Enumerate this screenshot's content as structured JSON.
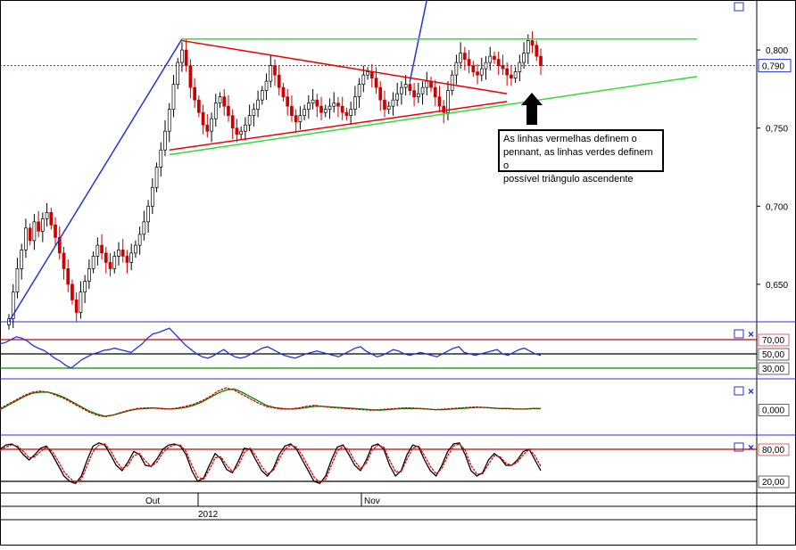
{
  "chart_data": [
    {
      "type": "candlestick",
      "panel": "price",
      "title": "",
      "y_ticks": [
        "0,800",
        "0,750",
        "0,700",
        "0,650"
      ],
      "ylim": [
        0.626,
        0.832
      ],
      "last_price_label": "0,790",
      "last_price": 0.79,
      "x_ticks": [
        "Out",
        "Nov"
      ],
      "year_label": "2012",
      "annotation": "As linhas vermelhas definem o pennant, as linhas verdes definem o possível triângulo ascendente",
      "annotation_lines": [
        "As linhas vermelhas definem o",
        "pennant, as linhas verdes definem o",
        "possível triângulo ascendente"
      ],
      "colors": {
        "up": "#000000",
        "down": "#cc0000",
        "pennant": "#ee0000",
        "triangle": "#33dd33",
        "trend": "#2233dd",
        "price_line": "#cc0000"
      },
      "close_series": [
        0.628,
        0.645,
        0.66,
        0.672,
        0.686,
        0.678,
        0.69,
        0.684,
        0.692,
        0.696,
        0.688,
        0.68,
        0.67,
        0.66,
        0.65,
        0.64,
        0.632,
        0.645,
        0.652,
        0.66,
        0.668,
        0.675,
        0.67,
        0.664,
        0.66,
        0.668,
        0.672,
        0.668,
        0.664,
        0.67,
        0.675,
        0.682,
        0.69,
        0.7,
        0.712,
        0.725,
        0.736,
        0.748,
        0.762,
        0.778,
        0.792,
        0.8,
        0.79,
        0.776,
        0.768,
        0.76,
        0.752,
        0.748,
        0.756,
        0.766,
        0.77,
        0.764,
        0.758,
        0.75,
        0.746,
        0.748,
        0.752,
        0.758,
        0.762,
        0.768,
        0.774,
        0.78,
        0.79,
        0.784,
        0.776,
        0.77,
        0.764,
        0.758,
        0.754,
        0.758,
        0.762,
        0.766,
        0.768,
        0.764,
        0.76,
        0.762,
        0.764,
        0.766,
        0.764,
        0.76,
        0.758,
        0.762,
        0.77,
        0.778,
        0.784,
        0.786,
        0.782,
        0.776,
        0.768,
        0.762,
        0.764,
        0.768,
        0.772,
        0.776,
        0.778,
        0.774,
        0.77,
        0.772,
        0.776,
        0.78,
        0.776,
        0.77,
        0.764,
        0.76,
        0.774,
        0.784,
        0.792,
        0.798,
        0.794,
        0.79,
        0.786,
        0.784,
        0.788,
        0.792,
        0.796,
        0.794,
        0.79,
        0.788,
        0.784,
        0.782,
        0.786,
        0.792,
        0.798,
        0.806,
        0.803,
        0.796,
        0.79
      ],
      "lines": [
        {
          "name": "trend-up-1",
          "color": "#2233dd",
          "from": [
            0,
            0.626
          ],
          "to": [
            41,
            0.807
          ]
        },
        {
          "name": "trend-up-2",
          "color": "#2233dd",
          "from": [
            95,
            0.78
          ],
          "to": [
            99,
            0.832
          ]
        },
        {
          "name": "pennant-upper",
          "color": "#ee0000",
          "from": [
            41,
            0.806
          ],
          "to": [
            118,
            0.772
          ]
        },
        {
          "name": "pennant-lower",
          "color": "#ee0000",
          "from": [
            38,
            0.736
          ],
          "to": [
            118,
            0.767
          ]
        },
        {
          "name": "triangle-top",
          "color": "#33dd33",
          "from": [
            41,
            0.807
          ],
          "to": [
            163,
            0.807
          ]
        },
        {
          "name": "triangle-bottom",
          "color": "#33dd33",
          "from": [
            38,
            0.733
          ],
          "to": [
            163,
            0.783
          ]
        }
      ]
    },
    {
      "type": "line",
      "panel": "rsi",
      "y_ticks": [
        "70,00",
        "50,00",
        "30,00"
      ],
      "ylim": [
        20,
        90
      ],
      "levels": [
        {
          "value": 70,
          "color": "#cc0000"
        },
        {
          "value": 50,
          "color": "#000000"
        },
        {
          "value": 30,
          "color": "#008800"
        }
      ],
      "series": [
        {
          "color": "#2233dd",
          "values": [
            64,
            66,
            70,
            74,
            72,
            68,
            62,
            58,
            55,
            50,
            44,
            40,
            34,
            30,
            36,
            42,
            46,
            50,
            52,
            55,
            56,
            58,
            56,
            54,
            52,
            58,
            64,
            72,
            78,
            80,
            83,
            86,
            78,
            70,
            62,
            56,
            50,
            46,
            44,
            47,
            52,
            56,
            50,
            46,
            44,
            46,
            50,
            54,
            58,
            60,
            56,
            52,
            48,
            46,
            44,
            47,
            50,
            52,
            54,
            52,
            50,
            48,
            46,
            50,
            54,
            58,
            60,
            54,
            50,
            46,
            48,
            52,
            56,
            54,
            50,
            48,
            50,
            52,
            50,
            48,
            46,
            50,
            54,
            58,
            60,
            52,
            50,
            48,
            50,
            52,
            54,
            56,
            50,
            48,
            52,
            56,
            58,
            54,
            50,
            48
          ]
        }
      ]
    },
    {
      "type": "line",
      "panel": "macd",
      "y_ticks": [
        "0,000"
      ],
      "ylim": [
        -0.04,
        0.05
      ],
      "series": [
        {
          "color": "#008800",
          "values": [
            0.0,
            0.008,
            0.016,
            0.024,
            0.03,
            0.032,
            0.032,
            0.028,
            0.022,
            0.014,
            0.006,
            -0.002,
            -0.008,
            -0.012,
            -0.01,
            -0.006,
            -0.002,
            0.001,
            0.002,
            0.003,
            0.002,
            0.001,
            0.002,
            0.004,
            0.008,
            0.014,
            0.022,
            0.03,
            0.036,
            0.038,
            0.032,
            0.024,
            0.016,
            0.008,
            0.004,
            0.002,
            0.001,
            0.002,
            0.004,
            0.006,
            0.006,
            0.005,
            0.004,
            0.003,
            0.002,
            0.001,
            0.0,
            -0.001,
            0.0,
            0.001,
            0.002,
            0.002,
            0.002,
            0.001,
            0.0,
            0.0,
            0.001,
            0.002,
            0.003,
            0.004,
            0.004,
            0.003,
            0.002,
            0.002,
            0.001,
            0.001,
            0.002,
            0.002
          ]
        },
        {
          "color": "#cc0000",
          "values": [
            0.002,
            0.01,
            0.018,
            0.026,
            0.032,
            0.034,
            0.032,
            0.026,
            0.02,
            0.012,
            0.004,
            -0.004,
            -0.01,
            -0.013,
            -0.01,
            -0.005,
            -0.001,
            0.002,
            0.003,
            0.003,
            0.002,
            0.001,
            0.003,
            0.006,
            0.01,
            0.016,
            0.024,
            0.034,
            0.04,
            0.036,
            0.028,
            0.02,
            0.012,
            0.006,
            0.003,
            0.001,
            0.001,
            0.003,
            0.006,
            0.008,
            0.006,
            0.004,
            0.003,
            0.002,
            0.001,
            0.0,
            -0.001,
            0.0,
            0.001,
            0.002,
            0.003,
            0.003,
            0.002,
            0.001,
            0.0,
            0.001,
            0.002,
            0.003,
            0.004,
            0.005,
            0.004,
            0.003,
            0.002,
            0.002,
            0.001,
            0.001,
            0.002,
            0.002
          ]
        }
      ]
    },
    {
      "type": "line",
      "panel": "stochastic",
      "y_ticks": [
        "80,00",
        "20,00"
      ],
      "ylim": [
        5,
        100
      ],
      "levels": [
        {
          "value": 80,
          "color": "#cc0000"
        },
        {
          "value": 20,
          "color": "#000000"
        }
      ],
      "series": [
        {
          "color": "#000000",
          "values": [
            80,
            88,
            90,
            84,
            70,
            60,
            70,
            82,
            86,
            70,
            50,
            30,
            20,
            16,
            30,
            60,
            86,
            92,
            88,
            70,
            50,
            40,
            56,
            76,
            70,
            50,
            48,
            62,
            80,
            88,
            90,
            86,
            70,
            40,
            20,
            26,
            50,
            72,
            62,
            42,
            36,
            58,
            82,
            80,
            60,
            40,
            30,
            44,
            70,
            86,
            90,
            80,
            60,
            40,
            20,
            16,
            30,
            60,
            84,
            88,
            70,
            50,
            40,
            60,
            86,
            90,
            80,
            50,
            30,
            40,
            70,
            88,
            84,
            60,
            40,
            30,
            50,
            76,
            90,
            92,
            70,
            40,
            30,
            36,
            60,
            72,
            64,
            50,
            50,
            60,
            76,
            80,
            60,
            40
          ]
        },
        {
          "color": "#ee0000",
          "values": [
            78,
            84,
            88,
            86,
            76,
            64,
            66,
            76,
            84,
            76,
            58,
            38,
            26,
            18,
            24,
            50,
            76,
            88,
            90,
            78,
            58,
            44,
            50,
            68,
            72,
            58,
            48,
            56,
            74,
            84,
            88,
            88,
            76,
            50,
            28,
            24,
            42,
            64,
            66,
            50,
            38,
            50,
            74,
            82,
            68,
            48,
            34,
            40,
            62,
            80,
            88,
            84,
            68,
            48,
            28,
            18,
            24,
            50,
            76,
            86,
            78,
            58,
            44,
            54,
            78,
            88,
            84,
            60,
            38,
            38,
            62,
            82,
            86,
            68,
            48,
            34,
            44,
            68,
            86,
            90,
            78,
            50,
            34,
            34,
            52,
            68,
            66,
            54,
            50,
            56,
            70,
            80,
            68,
            48
          ]
        }
      ]
    }
  ]
}
